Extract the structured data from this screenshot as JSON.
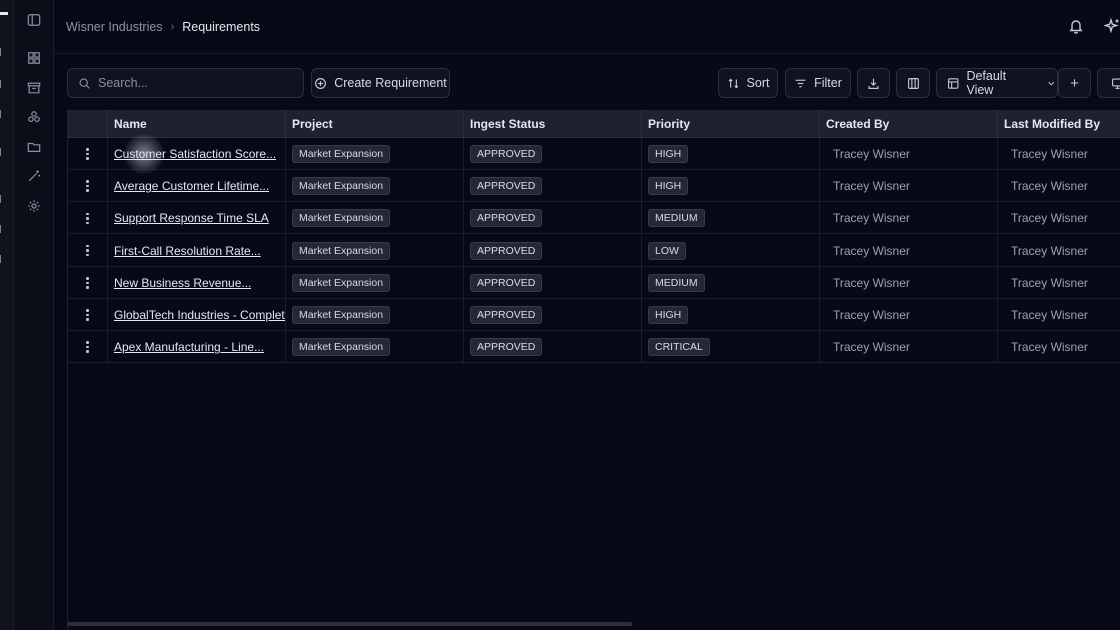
{
  "breadcrumb": {
    "org": "Wisner Industries",
    "separator": "›",
    "page": "Requirements"
  },
  "toolbar": {
    "search_placeholder": "Search...",
    "create_label": "Create Requirement",
    "sort_label": "Sort",
    "filter_label": "Filter",
    "view_label": "Default View",
    "add_label": "+"
  },
  "table": {
    "columns": [
      "Name",
      "Project",
      "Ingest Status",
      "Priority",
      "Created By",
      "Last Modified By"
    ],
    "rows": [
      {
        "name": "Customer Satisfaction Score...",
        "project": "Market Expansion",
        "status": "APPROVED",
        "priority": "HIGH",
        "created_by": "Tracey Wisner",
        "modified_by": "Tracey Wisner"
      },
      {
        "name": "Average Customer Lifetime...",
        "project": "Market Expansion",
        "status": "APPROVED",
        "priority": "HIGH",
        "created_by": "Tracey Wisner",
        "modified_by": "Tracey Wisner"
      },
      {
        "name": "Support Response Time SLA",
        "project": "Market Expansion",
        "status": "APPROVED",
        "priority": "MEDIUM",
        "created_by": "Tracey Wisner",
        "modified_by": "Tracey Wisner"
      },
      {
        "name": "First-Call Resolution Rate...",
        "project": "Market Expansion",
        "status": "APPROVED",
        "priority": "LOW",
        "created_by": "Tracey Wisner",
        "modified_by": "Tracey Wisner"
      },
      {
        "name": "New Business Revenue...",
        "project": "Market Expansion",
        "status": "APPROVED",
        "priority": "MEDIUM",
        "created_by": "Tracey Wisner",
        "modified_by": "Tracey Wisner"
      },
      {
        "name": "GlobalTech Industries - Complete...",
        "project": "Market Expansion",
        "status": "APPROVED",
        "priority": "HIGH",
        "created_by": "Tracey Wisner",
        "modified_by": "Tracey Wisner"
      },
      {
        "name": "Apex Manufacturing - Line...",
        "project": "Market Expansion",
        "status": "APPROVED",
        "priority": "CRITICAL",
        "created_by": "Tracey Wisner",
        "modified_by": "Tracey Wisner"
      }
    ]
  },
  "icons": {
    "sidebar": [
      "sidebar-toggle-icon",
      "dashboard-icon",
      "archive-icon",
      "components-icon",
      "folder-icon",
      "magic-wand-icon",
      "gear-icon"
    ],
    "header": [
      "bell-icon",
      "sparkle-icon"
    ],
    "toolbar": [
      "search-icon",
      "plus-circle-icon",
      "sort-icon",
      "filter-icon",
      "download-icon",
      "columns-icon",
      "layout-icon",
      "chevron-down-icon",
      "display-icon"
    ]
  }
}
